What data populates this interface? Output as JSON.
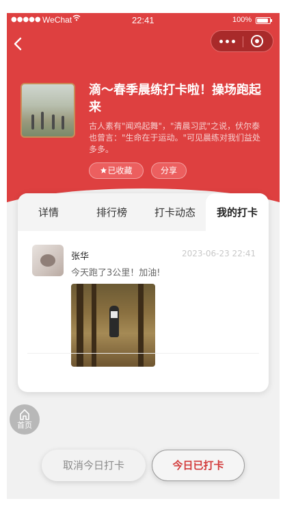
{
  "status_bar": {
    "carrier": "WeChat",
    "time": "22:41",
    "battery": "100%"
  },
  "activity": {
    "title": "滴～春季晨练打卡啦！操场跑起来",
    "description": "古人素有\"闻鸡起舞\"，\"清晨习武\"之说，伏尔泰也曾言：\"生命在于运动。\"可见晨练对我们益处多多。",
    "favorite_label": "已收藏",
    "share_label": "分享"
  },
  "tabs": [
    {
      "label": "详情",
      "active": false
    },
    {
      "label": "排行榜",
      "active": false
    },
    {
      "label": "打卡动态",
      "active": false
    },
    {
      "label": "我的打卡",
      "active": true
    }
  ],
  "checkins": [
    {
      "user": "张华",
      "time": "2023-06-23 22:41",
      "content": "今天跑了3公里！加油!"
    }
  ],
  "home": {
    "label": "首页"
  },
  "actions": {
    "cancel_label": "取消今日打卡",
    "done_label": "今日已打卡"
  },
  "colors": {
    "primary_red": "#de4040",
    "button_red": "#ec5f5f",
    "done_text": "#d23a3a"
  },
  "icons": [
    "back-arrow-icon",
    "more-dots-icon",
    "close-circle-icon",
    "star-icon",
    "home-icon"
  ]
}
